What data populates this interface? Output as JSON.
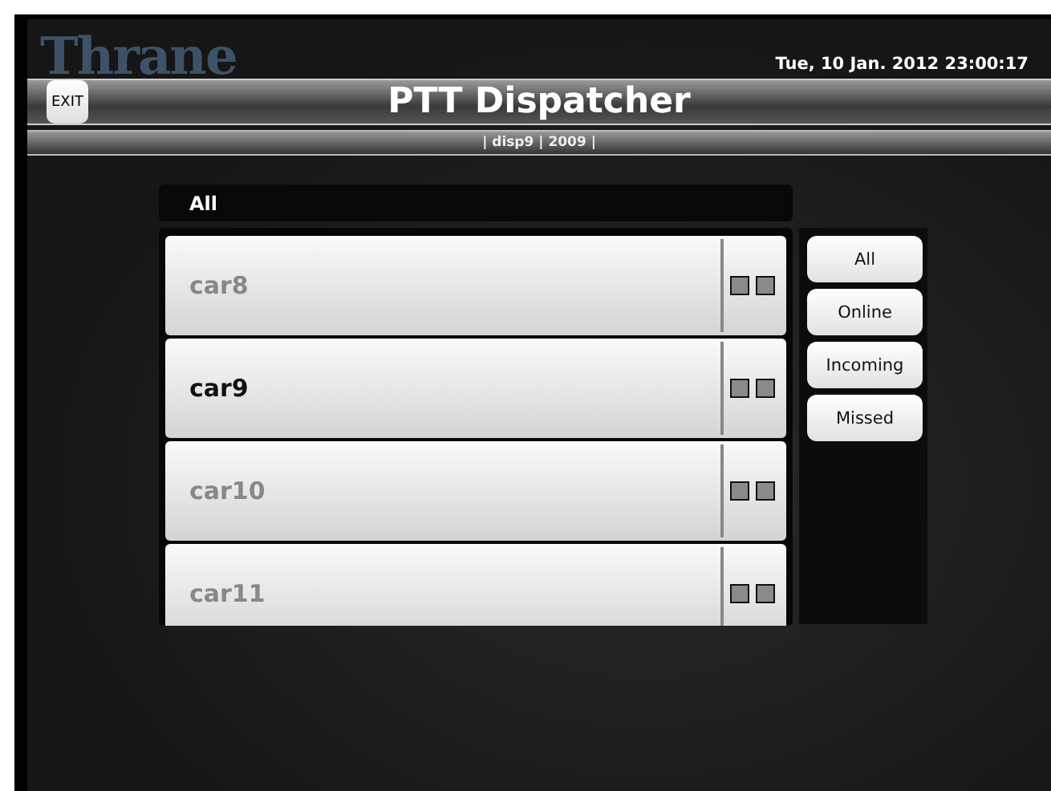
{
  "header": {
    "logo": "Thrane",
    "datetime": "Tue, 10 Jan. 2012 23:00:17",
    "exit_button": "EXIT",
    "title": "PTT Dispatcher",
    "subtitle": "| disp9 | 2009 |"
  },
  "list": {
    "heading": "All",
    "items": [
      {
        "name": "car8",
        "online": false
      },
      {
        "name": "car9",
        "online": true
      },
      {
        "name": "car10",
        "online": false
      },
      {
        "name": "car11",
        "online": false
      }
    ]
  },
  "filters": [
    {
      "label": "All"
    },
    {
      "label": "Online"
    },
    {
      "label": "Incoming"
    },
    {
      "label": "Missed"
    }
  ]
}
